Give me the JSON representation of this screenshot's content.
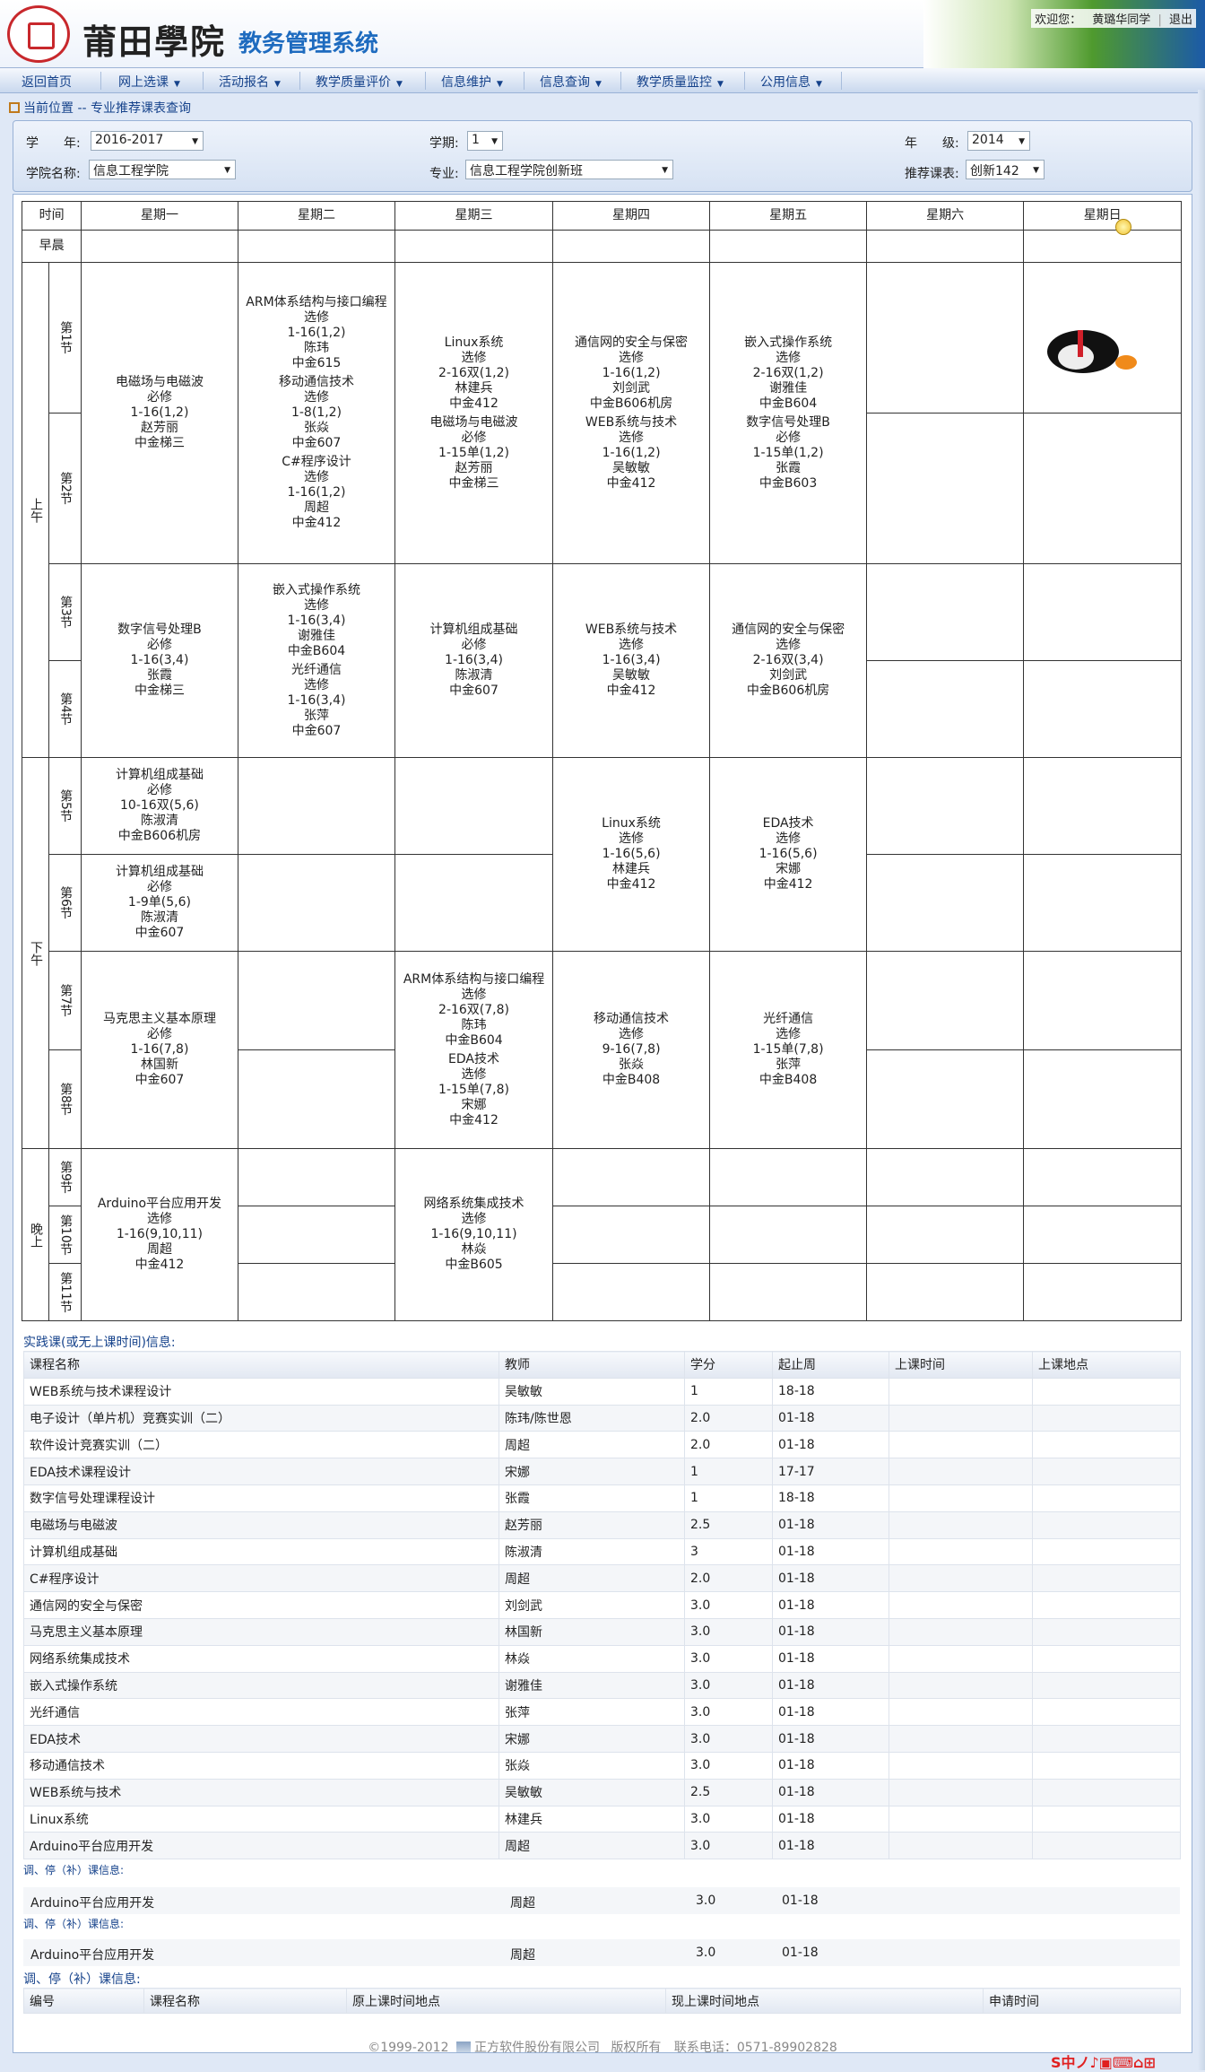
{
  "header": {
    "school_name": "莆田學院",
    "system_name": "教务管理系统",
    "welcome_prefix": "欢迎您：",
    "user_name": "黄璐华同学",
    "logout": "退出",
    "separator": "|"
  },
  "nav": {
    "home": "返回首页",
    "items": [
      "网上选课",
      "活动报名",
      "教学质量评价",
      "信息维护",
      "信息查询",
      "教学质量监控",
      "公用信息"
    ]
  },
  "breadcrumb": {
    "text": "当前位置",
    "path": " -- 专业推荐课表查询"
  },
  "filters": {
    "year_label": "学　　年:",
    "year": "2016-2017",
    "term_label": "学期:",
    "term": "1",
    "grade_label": "年　　级:",
    "grade": "2014",
    "college_label": "学院名称:",
    "college": "信息工程学院",
    "major_label": "专业:",
    "major": "信息工程学院创新班",
    "class_label": "推荐课表:",
    "class": "创新142"
  },
  "timetable": {
    "header_time": "时间",
    "days": [
      "星期一",
      "星期二",
      "星期三",
      "星期四",
      "星期五",
      "星期六",
      "星期日"
    ],
    "morning_label": "早晨",
    "periods": {
      "am": "上午",
      "pm": "下午",
      "eve": "晚上",
      "p1": "第1节",
      "p2": "第2节",
      "p3": "第3节",
      "p4": "第4节",
      "p5": "第5节",
      "p6": "第6节",
      "p7": "第7节",
      "p8": "第8节",
      "p9": "第9节",
      "p10": "第10节",
      "p11": "第11节"
    },
    "cells": {
      "mon_12": [
        [
          "电磁场与电磁波",
          "必修",
          "1-16(1,2)",
          "赵芳丽",
          "中金梯三"
        ]
      ],
      "tue_12": [
        [
          "ARM体系结构与接口编程",
          "选修",
          "1-16(1,2)",
          "陈玮",
          "中金615"
        ],
        [
          "移动通信技术",
          "选修",
          "1-8(1,2)",
          "张焱",
          "中金607"
        ],
        [
          "C#程序设计",
          "选修",
          "1-16(1,2)",
          "周超",
          "中金412"
        ]
      ],
      "wed_12": [
        [
          "Linux系统",
          "选修",
          "2-16双(1,2)",
          "林建兵",
          "中金412"
        ],
        [
          "电磁场与电磁波",
          "必修",
          "1-15单(1,2)",
          "赵芳丽",
          "中金梯三"
        ]
      ],
      "thu_12": [
        [
          "通信网的安全与保密",
          "选修",
          "1-16(1,2)",
          "刘剑武",
          "中金B606机房"
        ],
        [
          "WEB系统与技术",
          "选修",
          "1-16(1,2)",
          "吴敏敏",
          "中金412"
        ]
      ],
      "fri_12": [
        [
          "嵌入式操作系统",
          "选修",
          "2-16双(1,2)",
          "谢雅佳",
          "中金B604"
        ],
        [
          "数字信号处理B",
          "必修",
          "1-15单(1,2)",
          "张霞",
          "中金B603"
        ]
      ],
      "mon_34": [
        [
          "数字信号处理B",
          "必修",
          "1-16(3,4)",
          "张霞",
          "中金梯三"
        ]
      ],
      "tue_34": [
        [
          "嵌入式操作系统",
          "选修",
          "1-16(3,4)",
          "谢雅佳",
          "中金B604"
        ],
        [
          "光纤通信",
          "选修",
          "1-16(3,4)",
          "张萍",
          "中金607"
        ]
      ],
      "wed_34": [
        [
          "计算机组成基础",
          "必修",
          "1-16(3,4)",
          "陈淑清",
          "中金607"
        ]
      ],
      "thu_34": [
        [
          "WEB系统与技术",
          "选修",
          "1-16(3,4)",
          "吴敏敏",
          "中金412"
        ]
      ],
      "fri_34": [
        [
          "通信网的安全与保密",
          "选修",
          "2-16双(3,4)",
          "刘剑武",
          "中金B606机房"
        ]
      ],
      "mon_5": [
        [
          "计算机组成基础",
          "必修",
          "10-16双(5,6)",
          "陈淑清",
          "中金B606机房"
        ]
      ],
      "mon_6": [
        [
          "计算机组成基础",
          "必修",
          "1-9单(5,6)",
          "陈淑清",
          "中金607"
        ]
      ],
      "thu_56": [
        [
          "Linux系统",
          "选修",
          "1-16(5,6)",
          "林建兵",
          "中金412"
        ]
      ],
      "fri_56": [
        [
          "EDA技术",
          "选修",
          "1-16(5,6)",
          "宋娜",
          "中金412"
        ]
      ],
      "mon_78": [
        [
          "马克思主义基本原理",
          "必修",
          "1-16(7,8)",
          "林国新",
          "中金607"
        ]
      ],
      "wed_78": [
        [
          "ARM体系结构与接口编程",
          "选修",
          "2-16双(7,8)",
          "陈玮",
          "中金B604"
        ],
        [
          "EDA技术",
          "选修",
          "1-15单(7,8)",
          "宋娜",
          "中金412"
        ]
      ],
      "thu_78": [
        [
          "移动通信技术",
          "选修",
          "9-16(7,8)",
          "张焱",
          "中金B408"
        ]
      ],
      "fri_78": [
        [
          "光纤通信",
          "选修",
          "1-15单(7,8)",
          "张萍",
          "中金B408"
        ]
      ],
      "mon_911": [
        [
          "Arduino平台应用开发",
          "选修",
          "1-16(9,10,11)",
          "周超",
          "中金412"
        ]
      ],
      "wed_911": [
        [
          "网络系统集成技术",
          "选修",
          "1-16(9,10,11)",
          "林焱",
          "中金B605"
        ]
      ]
    }
  },
  "practice": {
    "title": "实践课(或无上课时间)信息:",
    "columns": [
      "课程名称",
      "教师",
      "学分",
      "起止周",
      "上课时间",
      "上课地点"
    ],
    "rows": [
      [
        "WEB系统与技术课程设计",
        "吴敏敏",
        "1",
        "18-18",
        "",
        ""
      ],
      [
        "电子设计（单片机）竞赛实训（二）",
        "陈玮/陈世恩",
        "2.0",
        "01-18",
        "",
        ""
      ],
      [
        "软件设计竞赛实训（二）",
        "周超",
        "2.0",
        "01-18",
        "",
        ""
      ],
      [
        "EDA技术课程设计",
        "宋娜",
        "1",
        "17-17",
        "",
        ""
      ],
      [
        "数字信号处理课程设计",
        "张霞",
        "1",
        "18-18",
        "",
        ""
      ],
      [
        "电磁场与电磁波",
        "赵芳丽",
        "2.5",
        "01-18",
        "",
        ""
      ],
      [
        "计算机组成基础",
        "陈淑清",
        "3",
        "01-18",
        "",
        ""
      ],
      [
        "C#程序设计",
        "周超",
        "2.0",
        "01-18",
        "",
        ""
      ],
      [
        "通信网的安全与保密",
        "刘剑武",
        "3.0",
        "01-18",
        "",
        ""
      ],
      [
        "马克思主义基本原理",
        "林国新",
        "3.0",
        "01-18",
        "",
        ""
      ],
      [
        "网络系统集成技术",
        "林焱",
        "3.0",
        "01-18",
        "",
        ""
      ],
      [
        "嵌入式操作系统",
        "谢雅佳",
        "3.0",
        "01-18",
        "",
        ""
      ],
      [
        "光纤通信",
        "张萍",
        "3.0",
        "01-18",
        "",
        ""
      ],
      [
        "EDA技术",
        "宋娜",
        "3.0",
        "01-18",
        "",
        ""
      ],
      [
        "移动通信技术",
        "张焱",
        "3.0",
        "01-18",
        "",
        ""
      ],
      [
        "WEB系统与技术",
        "吴敏敏",
        "2.5",
        "01-18",
        "",
        ""
      ],
      [
        "Linux系统",
        "林建兵",
        "3.0",
        "01-18",
        "",
        ""
      ],
      [
        "Arduino平台应用开发",
        "周超",
        "3.0",
        "01-18",
        "",
        ""
      ]
    ],
    "ghost_rows": [
      [
        "Arduino平台应用开发",
        "周超",
        "3.0",
        "01-18"
      ],
      [
        "Arduino平台应用开发",
        "周超",
        "3.0",
        "01-18"
      ]
    ]
  },
  "adjust": {
    "title": "调、停（补）课信息:",
    "columns": [
      "编号",
      "课程名称",
      "原上课时间地点",
      "现上课时间地点",
      "申请时间"
    ]
  },
  "footer": {
    "copyright": "©1999-2012",
    "company": "正方软件股份有限公司",
    "rights": "版权所有",
    "phone": "联系电话：0571-89902828"
  },
  "ime": {
    "text": "S中ノ♪▣⌨⌂⊞"
  }
}
